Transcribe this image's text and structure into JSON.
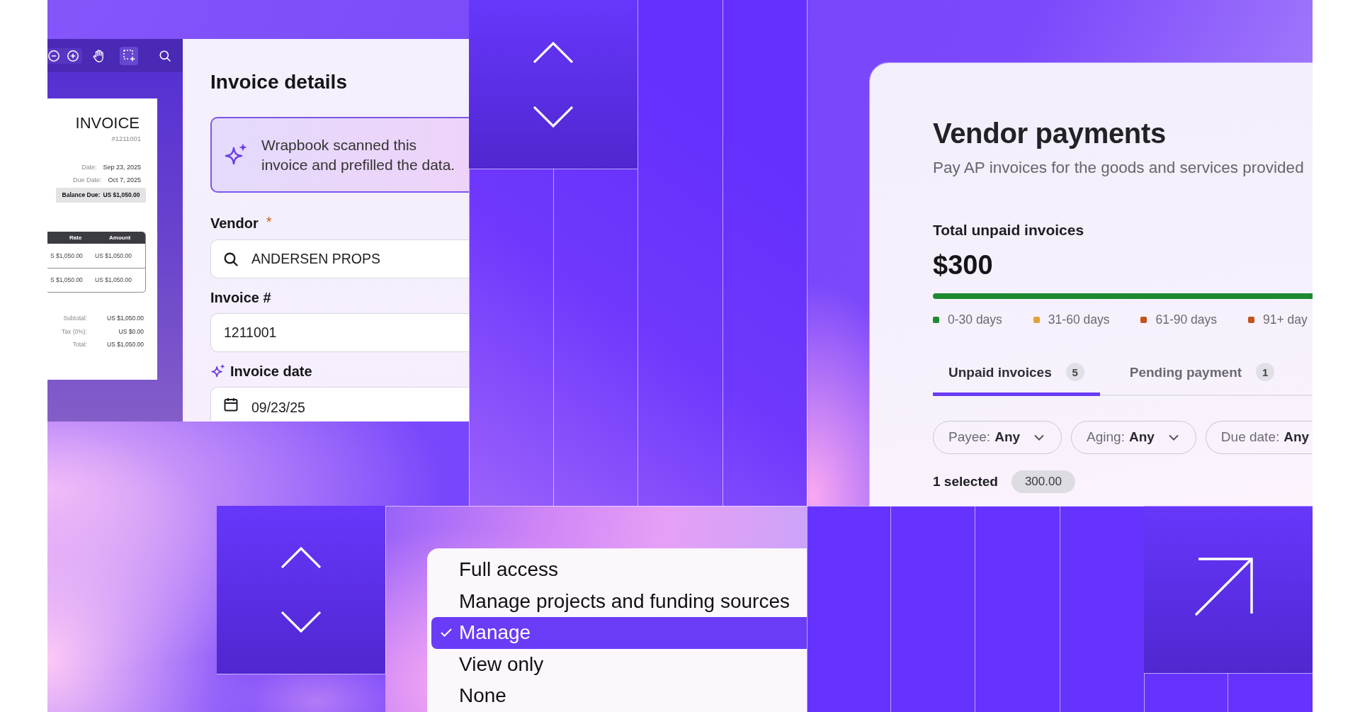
{
  "invoice_viewer": {
    "tools": [
      {
        "kind": "zoom_out",
        "selected": false
      },
      {
        "kind": "zoom_in",
        "selected": false
      },
      {
        "kind": "pan",
        "selected": false
      },
      {
        "kind": "select_area",
        "selected": true
      },
      {
        "kind": "search",
        "selected": false
      }
    ],
    "document": {
      "title": "INVOICE",
      "number": "#1211001",
      "dates": [
        {
          "label": "Date:",
          "value": "Sep 23, 2025"
        },
        {
          "label": "Due Date:",
          "value": "Oct 7, 2025"
        }
      ],
      "balance": {
        "label": "Balance Due:",
        "value": "US $1,050.00"
      },
      "table": {
        "columns": [
          "Rate",
          "Amount"
        ],
        "rows": [
          [
            "S $1,050.00",
            "US $1,050.00"
          ],
          [
            "S $1,050.00",
            "US $1,050.00"
          ]
        ]
      },
      "totals": [
        {
          "label": "Subtotal:",
          "value": "US $1,050.00"
        },
        {
          "label": "Tax (0%):",
          "value": "US $0.00"
        },
        {
          "label": "Total:",
          "value": "US $1,050.00"
        }
      ]
    }
  },
  "invoice_details": {
    "title": "Invoice details",
    "notice": "Wrapbook scanned this invoice and prefilled the data.",
    "fields": [
      {
        "label": "Vendor",
        "required_mark": "*",
        "ai_filled": false,
        "kind": "search",
        "value": "ANDERSEN PROPS"
      },
      {
        "label": "Invoice #",
        "ai_filled": false,
        "kind": "text",
        "value": "1211001"
      },
      {
        "label": "Invoice date",
        "ai_filled": true,
        "kind": "date",
        "value": "09/23/25"
      }
    ]
  },
  "vendor_payments": {
    "title": "Vendor payments",
    "subtitle": "Pay AP invoices for the goods and services provided",
    "summary": {
      "label": "Total unpaid invoices",
      "amount": "$300",
      "level": 1
    },
    "legend": [
      {
        "label": "0-30 days",
        "color": "#1f8a34"
      },
      {
        "label": "31-60 days",
        "color": "#e2a23c"
      },
      {
        "label": "61-90 days",
        "color": "#c4521d"
      },
      {
        "label": "91+ day",
        "color": "#c4521d"
      }
    ],
    "tabs": [
      {
        "label": "Unpaid invoices",
        "count": "5",
        "selected": true
      },
      {
        "label": "Pending payment",
        "count": "1",
        "selected": false
      }
    ],
    "filters": [
      {
        "label": "Payee:",
        "value": "Any",
        "caret": true
      },
      {
        "label": "Aging:",
        "value": "Any",
        "caret": true
      },
      {
        "label": "Due date:",
        "value": "Any",
        "caret": false
      }
    ],
    "selection": {
      "label": "1 selected",
      "amount": "300.00"
    }
  },
  "access_menu": {
    "items": [
      {
        "label": "Full access",
        "selected": false
      },
      {
        "label": "Manage projects and funding sources",
        "selected": false
      },
      {
        "label": "Manage",
        "selected": true
      },
      {
        "label": "View only",
        "selected": false
      },
      {
        "label": "None",
        "selected": false
      }
    ]
  }
}
